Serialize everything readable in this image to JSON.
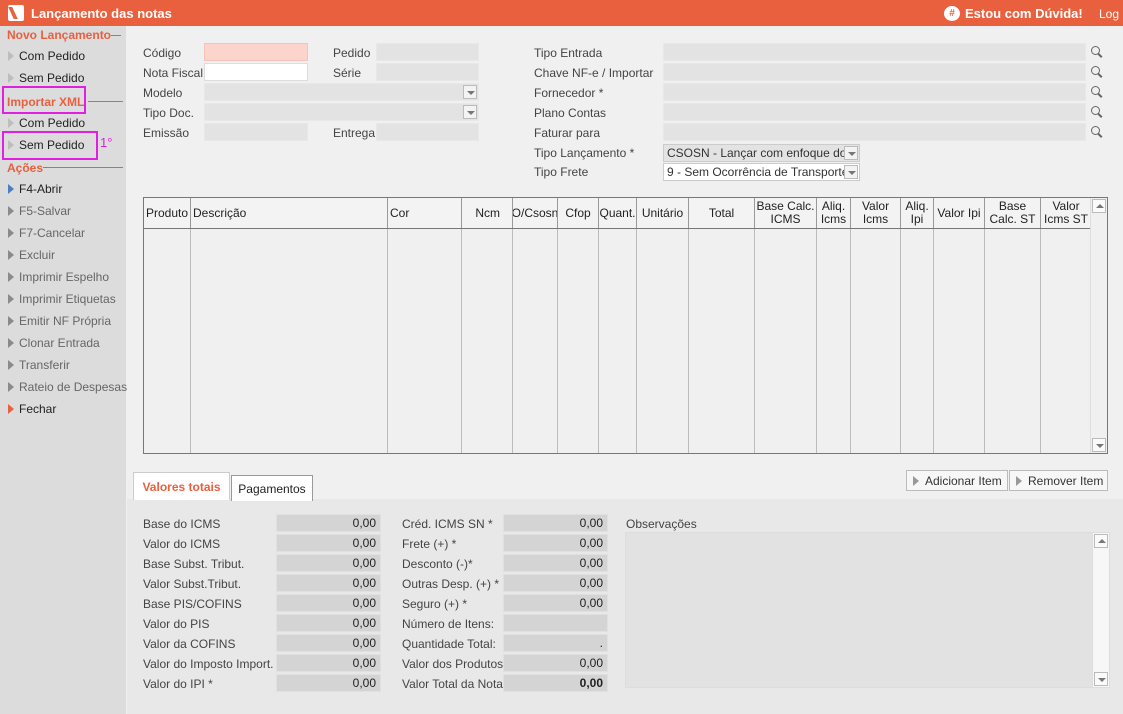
{
  "titlebar": {
    "title": "Lançamento das notas",
    "help_label": "Estou com Dúvida!",
    "help_icon_glyph": "#",
    "log_label": "Log"
  },
  "sidebar": {
    "novo_section": "Novo Lançamento",
    "novo_items": [
      "Com Pedido",
      "Sem Pedido"
    ],
    "xml_section": "Importar XML",
    "xml_items": [
      "Com Pedido",
      "Sem Pedido"
    ],
    "annotation": "1°",
    "acoes_section": "Ações",
    "acoes_items": [
      "F4-Abrir",
      "F5-Salvar",
      "F7-Cancelar",
      "Excluir",
      "Imprimir Espelho",
      "Imprimir Etiquetas",
      "Emitir NF Própria",
      "Clonar Entrada",
      "Transferir",
      "Rateio de Despesas",
      "Fechar"
    ]
  },
  "form": {
    "codigo_label": "Código",
    "pedido_label": "Pedido",
    "nota_fiscal_label": "Nota Fiscal",
    "serie_label": "Série",
    "modelo_label": "Modelo",
    "tipo_doc_label": "Tipo Doc.",
    "emissao_label": "Emissão",
    "entrega_label": "Entrega",
    "tipo_entrada_label": "Tipo Entrada",
    "chave_label": "Chave NF-e / Importar",
    "fornecedor_label": "Fornecedor *",
    "plano_contas_label": "Plano Contas",
    "faturar_para_label": "Faturar para",
    "tipo_lancamento_label": "Tipo Lançamento *",
    "tipo_lancamento_value": "CSOSN - Lançar com enfoque do",
    "tipo_frete_label": "Tipo Frete",
    "tipo_frete_value": "9 - Sem Ocorrência de Transporte"
  },
  "grid": {
    "columns": [
      "Produto",
      "Descrição",
      "Cor",
      "Ncm",
      "O/Csosn",
      "Cfop",
      "Quant.",
      "Unitário",
      "Total",
      "Base Calc. ICMS",
      "Aliq. Icms",
      "Valor Icms",
      "Aliq. Ipi",
      "Valor Ipi",
      "Base Calc. ST",
      "Valor Icms ST"
    ]
  },
  "tabs": [
    "Valores totais",
    "Pagamentos"
  ],
  "buttons": {
    "add_item": "Adicionar Item",
    "remove_item": "Remover Item"
  },
  "totals_left": [
    {
      "label": "Base do ICMS",
      "value": "0,00"
    },
    {
      "label": "Valor do ICMS",
      "value": "0,00"
    },
    {
      "label": "Base Subst. Tribut.",
      "value": "0,00"
    },
    {
      "label": "Valor Subst.Tribut.",
      "value": "0,00"
    },
    {
      "label": "Base PIS/COFINS",
      "value": "0,00"
    },
    {
      "label": "Valor do PIS",
      "value": "0,00"
    },
    {
      "label": "Valor da COFINS",
      "value": "0,00"
    },
    {
      "label": "Valor do Imposto Import.",
      "value": "0,00"
    },
    {
      "label": "Valor do IPI *",
      "value": "0,00"
    }
  ],
  "totals_right": [
    {
      "label": "Créd. ICMS SN *",
      "value": "0,00"
    },
    {
      "label": "Frete (+) *",
      "value": "0,00"
    },
    {
      "label": "Desconto (-)*",
      "value": "0,00"
    },
    {
      "label": "Outras Desp. (+) *",
      "value": "0,00"
    },
    {
      "label": "Seguro (+) *",
      "value": "0,00"
    },
    {
      "label": "Número de Itens:",
      "value": ""
    },
    {
      "label": "Quantidade Total:",
      "value": "."
    },
    {
      "label": "Valor dos Produtos",
      "value": "0,00"
    },
    {
      "label": "Valor Total da Nota",
      "value": "0,00"
    }
  ],
  "observacoes_label": "Observações",
  "colors": {
    "accent": "#e9603f",
    "highlight": "#e020e0"
  }
}
